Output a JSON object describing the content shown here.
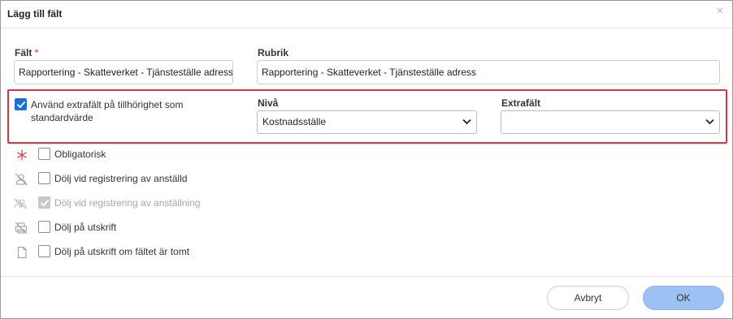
{
  "dialog": {
    "title": "Lägg till fält",
    "close_symbol": "×"
  },
  "fields": {
    "falt_label": "Fält",
    "required_mark": "*",
    "falt_value": "Rapportering - Skatteverket - Tjänsteställe adress",
    "rubrik_label": "Rubrik",
    "rubrik_value": "Rapportering - Skatteverket - Tjänsteställe adress"
  },
  "extrafield": {
    "checkbox_label_line1": "Använd extrafält på tillhörighet som",
    "checkbox_label_line2": "standardvärde",
    "checked": true,
    "niva_label": "Nivå",
    "niva_value": "Kostnadsställe",
    "extrafalt_label": "Extrafält",
    "extrafalt_value": ""
  },
  "options": [
    {
      "label": "Obligatorisk",
      "icon": "asterisk-icon",
      "checked": false,
      "disabled": false
    },
    {
      "label": "Dölj vid registrering av anställd",
      "icon": "user-hidden-icon",
      "checked": false,
      "disabled": false
    },
    {
      "label": "Dölj vid registrering av anställning",
      "icon": "users-hidden-icon",
      "checked": true,
      "disabled": true
    },
    {
      "label": "Dölj på utskrift",
      "icon": "printer-hidden-icon",
      "checked": false,
      "disabled": false
    },
    {
      "label": "Dölj på utskrift om fältet är tomt",
      "icon": "document-icon",
      "checked": false,
      "disabled": false
    }
  ],
  "buttons": {
    "cancel": "Avbryt",
    "ok": "OK"
  },
  "colors": {
    "highlight": "#d8363e",
    "checkbox_checked": "#1d6fd8",
    "ok_button": "#9cc1f2",
    "required": "#d0202a"
  }
}
